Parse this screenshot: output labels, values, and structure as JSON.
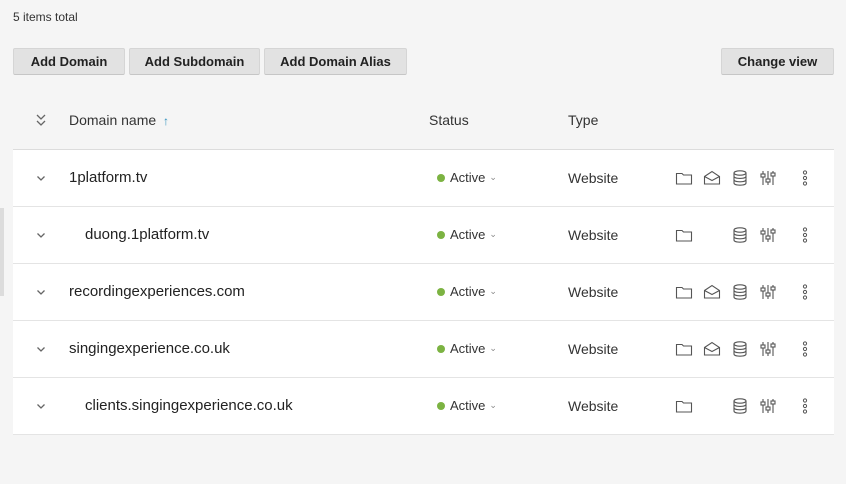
{
  "summary": {
    "items_total": "5 items total"
  },
  "toolbar": {
    "add_domain": "Add Domain",
    "add_subdomain": "Add Subdomain",
    "add_alias": "Add Domain Alias",
    "change_view": "Change view"
  },
  "table": {
    "headers": {
      "domain_name": "Domain name",
      "sort_indicator": "↑",
      "status": "Status",
      "type": "Type"
    },
    "rows": [
      {
        "name": "1platform.tv",
        "status": "Active",
        "type": "Website",
        "mail": true
      },
      {
        "name": "duong.1platform.tv",
        "status": "Active",
        "type": "Website",
        "mail": false
      },
      {
        "name": "recordingexperiences.com",
        "status": "Active",
        "type": "Website",
        "mail": true
      },
      {
        "name": "singingexperience.co.uk",
        "status": "Active",
        "type": "Website",
        "mail": true
      },
      {
        "name": "clients.singingexperience.co.uk",
        "status": "Active",
        "type": "Website",
        "mail": false
      }
    ]
  },
  "colors": {
    "status_active": "#7cb342",
    "sort_arrow": "#2d8fbd",
    "icon": "#555555"
  },
  "icons": {
    "expand_all": "double-chevron-down-icon",
    "row_expand": "chevron-down-icon",
    "files": "folder-icon",
    "mail": "envelope-icon",
    "databases": "database-icon",
    "settings": "sliders-icon",
    "more": "kebab-menu-icon"
  }
}
